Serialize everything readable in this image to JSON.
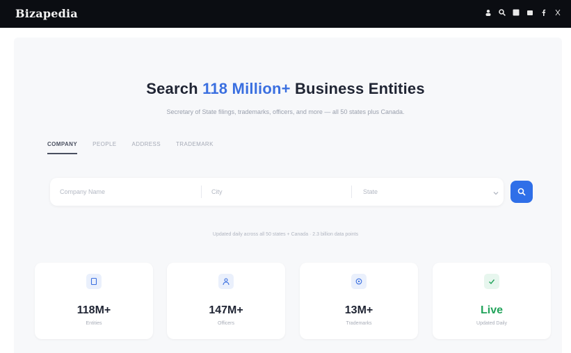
{
  "brand": {
    "name": "Bizapedia"
  },
  "hero": {
    "title_prefix": "Search ",
    "title_accent": "118 Million+",
    "title_suffix": " Business Entities",
    "subtitle": "Secretary of State filings, trademarks, officers, and more — all 50 states plus Canada."
  },
  "tabs": [
    {
      "label": "COMPANY",
      "active": true
    },
    {
      "label": "PEOPLE",
      "active": false
    },
    {
      "label": "ADDRESS",
      "active": false
    },
    {
      "label": "TRADEMARK",
      "active": false
    }
  ],
  "search": {
    "company_placeholder": "Company Name",
    "city_placeholder": "City",
    "state_value": "State"
  },
  "meta_note": "Updated daily across all 50 states + Canada · 2.3 billion data points",
  "stats": [
    {
      "icon": "building-icon",
      "value": "118M+",
      "label": "Entities",
      "color": "#3a6fe0"
    },
    {
      "icon": "person-icon",
      "value": "147M+",
      "label": "Officers",
      "color": "#3a6fe0"
    },
    {
      "icon": "trademark-icon",
      "value": "13M+",
      "label": "Trademarks",
      "color": "#3a6fe0"
    },
    {
      "icon": "check-icon",
      "value": "Live",
      "label": "Updated Daily",
      "color": "#21a35a"
    }
  ],
  "colors": {
    "accent": "#3a6fe0",
    "topbar": "#0b0d12",
    "live": "#21a35a"
  }
}
